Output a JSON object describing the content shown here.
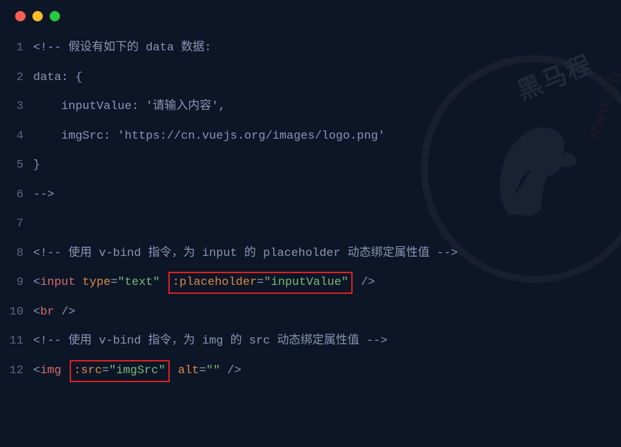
{
  "window_controls": {
    "red": "#ff5f56",
    "yellow": "#ffbd2e",
    "green": "#27c93f"
  },
  "watermark": {
    "text1": "黑马程",
    "text2": "www.ith"
  },
  "lines": [
    {
      "n": "1",
      "tokens": [
        {
          "cls": "t-punc",
          "txt": "<!--"
        },
        {
          "cls": "t-comment",
          "txt": " 假设有如下的 data 数据:"
        }
      ]
    },
    {
      "n": "2",
      "tokens": [
        {
          "cls": "t-comment",
          "txt": "data: {"
        }
      ]
    },
    {
      "n": "3",
      "tokens": [
        {
          "cls": "t-comment",
          "txt": "    inputValue: '请输入内容',"
        }
      ]
    },
    {
      "n": "4",
      "tokens": [
        {
          "cls": "t-comment",
          "txt": "    imgSrc: 'https://cn.vuejs.org/images/logo.png'"
        }
      ]
    },
    {
      "n": "5",
      "tokens": [
        {
          "cls": "t-comment",
          "txt": "}"
        }
      ]
    },
    {
      "n": "6",
      "tokens": [
        {
          "cls": "t-punc",
          "txt": "-->"
        }
      ]
    },
    {
      "n": "7",
      "tokens": []
    },
    {
      "n": "8",
      "tokens": [
        {
          "cls": "t-punc",
          "txt": "<!--"
        },
        {
          "cls": "t-comment",
          "txt": " 使用 v-bind 指令，为 input 的 placeholder 动态绑定属性值 "
        },
        {
          "cls": "t-punc",
          "txt": "-->"
        }
      ]
    },
    {
      "n": "9",
      "tokens": [
        {
          "cls": "t-punc",
          "txt": "<"
        },
        {
          "cls": "t-tag",
          "txt": "input"
        },
        {
          "cls": "",
          "txt": " "
        },
        {
          "cls": "t-attr",
          "txt": "type"
        },
        {
          "cls": "t-punc",
          "txt": "="
        },
        {
          "cls": "t-str",
          "txt": "\"text\""
        },
        {
          "cls": "",
          "txt": " "
        },
        {
          "box": true,
          "inner": [
            {
              "cls": "t-attr",
              "txt": ":placeholder"
            },
            {
              "cls": "t-punc",
              "txt": "="
            },
            {
              "cls": "t-str",
              "txt": "\"inputValue\""
            }
          ]
        },
        {
          "cls": "",
          "txt": " "
        },
        {
          "cls": "t-punc",
          "txt": "/>"
        }
      ]
    },
    {
      "n": "10",
      "tokens": [
        {
          "cls": "t-punc",
          "txt": "<"
        },
        {
          "cls": "t-tag",
          "txt": "br"
        },
        {
          "cls": "",
          "txt": " "
        },
        {
          "cls": "t-punc",
          "txt": "/>"
        }
      ]
    },
    {
      "n": "11",
      "tokens": [
        {
          "cls": "t-punc",
          "txt": "<!--"
        },
        {
          "cls": "t-comment",
          "txt": " 使用 v-bind 指令，为 img 的 src 动态绑定属性值 "
        },
        {
          "cls": "t-punc",
          "txt": "-->"
        }
      ]
    },
    {
      "n": "12",
      "tokens": [
        {
          "cls": "t-punc",
          "txt": "<"
        },
        {
          "cls": "t-tag",
          "txt": "img"
        },
        {
          "cls": "",
          "txt": " "
        },
        {
          "box": true,
          "inner": [
            {
              "cls": "t-attr",
              "txt": ":src"
            },
            {
              "cls": "t-punc",
              "txt": "="
            },
            {
              "cls": "t-str",
              "txt": "\"imgSrc\""
            }
          ]
        },
        {
          "cls": "",
          "txt": " "
        },
        {
          "cls": "t-attr",
          "txt": "alt"
        },
        {
          "cls": "t-punc",
          "txt": "="
        },
        {
          "cls": "t-str",
          "txt": "\"\""
        },
        {
          "cls": "",
          "txt": " "
        },
        {
          "cls": "t-punc",
          "txt": "/>"
        }
      ]
    }
  ]
}
